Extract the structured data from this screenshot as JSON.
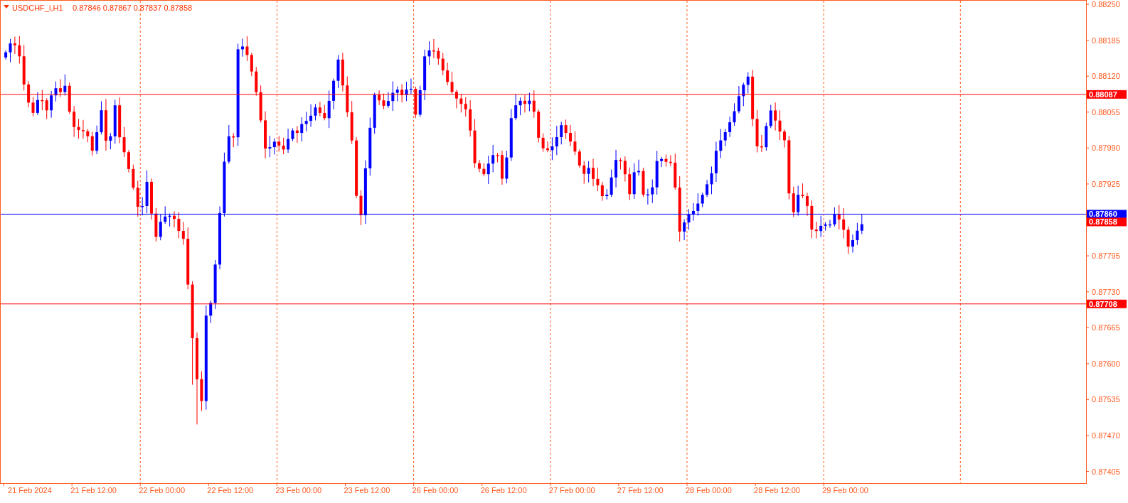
{
  "header": {
    "symbol": "USDCHF_i,H1",
    "quotes": "0.87846 0.87867 0.87837 0.87858"
  },
  "price_axis": {
    "labels": [
      "0.88250",
      "0.88185",
      "0.88120",
      "0.88055",
      "0.87990",
      "0.87925",
      "0.87795",
      "0.87730",
      "0.87665",
      "0.87600",
      "0.87535",
      "0.87470",
      "0.87405"
    ]
  },
  "time_axis": {
    "labels": [
      "21 Feb 2024",
      "21 Feb 12:00",
      "22 Feb 00:00",
      "22 Feb 12:00",
      "23 Feb 00:00",
      "23 Feb 12:00",
      "26 Feb 00:00",
      "26 Feb 12:00",
      "27 Feb 00:00",
      "27 Feb 12:00",
      "28 Feb 00:00",
      "28 Feb 12:00",
      "29 Feb 00:00"
    ]
  },
  "price_lines": [
    {
      "label": "0.88087",
      "color": "#ff0000"
    },
    {
      "label": "0.87860",
      "color": "#0000ff"
    },
    {
      "label": "0.87708",
      "color": "#ff0000"
    }
  ],
  "current_price": {
    "label": "0.87858",
    "color": "#ff0000"
  }
}
